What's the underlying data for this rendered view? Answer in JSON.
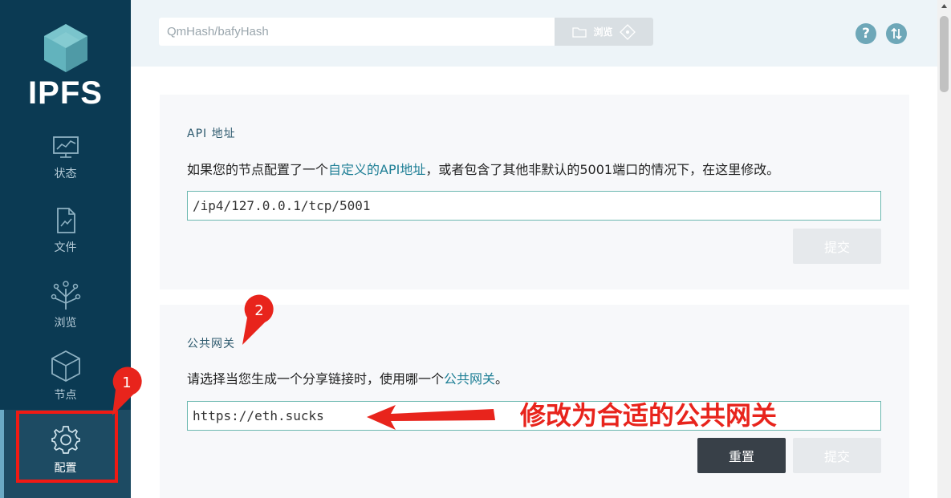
{
  "app": {
    "logo_text": "IPFS"
  },
  "sidebar": {
    "items": [
      {
        "label": "状态",
        "icon": "status-chart-icon",
        "active": false
      },
      {
        "label": "文件",
        "icon": "file-icon",
        "active": false
      },
      {
        "label": "浏览",
        "icon": "tree-icon",
        "active": false
      },
      {
        "label": "节点",
        "icon": "cube-icon",
        "active": false
      },
      {
        "label": "配置",
        "icon": "gear-icon",
        "active": true
      }
    ]
  },
  "topbar": {
    "search_placeholder": "QmHash/bafyHash",
    "browse_label": "浏览",
    "help_icon": "question-icon",
    "sync_icon": "sync-icon"
  },
  "api_section": {
    "title": "API 地址",
    "desc_before": "如果您的节点配置了一个",
    "desc_link": "自定义的API地址",
    "desc_after": "，或者包含了其他非默认的5001端口的情况下，在这里修改。",
    "value": "/ip4/127.0.0.1/tcp/5001",
    "submit_label": "提交"
  },
  "gateway_section": {
    "title": "公共网关",
    "desc_before": "请选择当您生成一个分享链接时，使用哪一个",
    "desc_link": "公共网关",
    "desc_after": "。",
    "value": "https://eth.sucks",
    "reset_label": "重置",
    "submit_label": "提交"
  },
  "annotations": {
    "marker_1": "1",
    "marker_2": "2",
    "note": "修改为合适的公共网关"
  },
  "colors": {
    "sidebar_bg": "#0b3a53",
    "accent": "#1d7e95",
    "annotation_red": "#f01a14"
  }
}
